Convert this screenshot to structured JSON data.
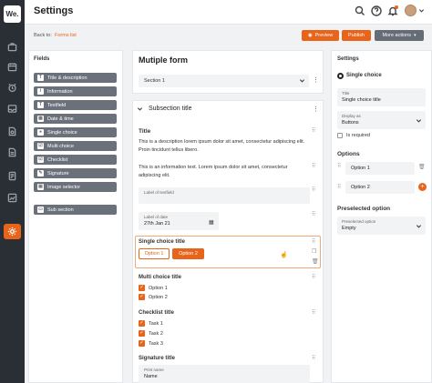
{
  "app": {
    "logo": "We.",
    "title": "Settings"
  },
  "breadcrumb": {
    "back_label": "Back to:",
    "link": "Forms list"
  },
  "actions": {
    "preview": "Preview",
    "publish": "Publish",
    "more": "More actions"
  },
  "fields_panel": {
    "title": "Fields",
    "items": [
      {
        "icon": "T",
        "label": "Title & description"
      },
      {
        "icon": "i",
        "label": "Information"
      },
      {
        "icon": "T",
        "label": "Textfield"
      },
      {
        "icon": "▦",
        "label": "Date & time"
      },
      {
        "icon": "●",
        "label": "Single choice"
      },
      {
        "icon": "☑",
        "label": "Multi choice"
      },
      {
        "icon": "☑",
        "label": "Checklist"
      },
      {
        "icon": "✎",
        "label": "Signature"
      },
      {
        "icon": "▣",
        "label": "Image selector"
      }
    ],
    "sub_section": "Sub section"
  },
  "form": {
    "title": "Mutiple form",
    "section_select": "Section 1",
    "subsection_title": "Subsection title",
    "title_block": {
      "title": "Title",
      "description": "This is a description lorem ipsum dolor sit amet, consectetur adipiscing elit. Proin tincidunt tellus libero.",
      "info": "This is an information text. Lorem ipsum dolor sit amet, consectetur adipiscing elit."
    },
    "textfield_label": "Label of textfield",
    "date": {
      "label": "Label of date",
      "value": "27th Jan 21"
    },
    "single_choice": {
      "title": "Single choice title",
      "option1": "Option 1",
      "option2": "Option 2"
    },
    "multi_choice": {
      "title": "Multi choice title",
      "options": [
        "Option 1",
        "Option 2"
      ]
    },
    "checklist": {
      "title": "Checklist title",
      "tasks": [
        "Task 1",
        "Task 2",
        "Task 3"
      ]
    },
    "signature": {
      "title": "Signature title",
      "print_label": "Print name",
      "print_value": "Name"
    }
  },
  "settings_panel": {
    "title": "Settings",
    "field_type": "Single choice",
    "title_label": "Title",
    "title_value": "Single choice title",
    "display_label": "Display as",
    "display_value": "Buttons",
    "required": "Is required",
    "options_heading": "Options",
    "options": [
      "Option 1",
      "Option 2"
    ],
    "preselected_heading": "Preselected option",
    "preselected_label": "Preselected option",
    "preselected_value": "Empty"
  },
  "colors": {
    "accent": "#e8641b",
    "rail": "#2a2f36",
    "palette_item": "#6b717a"
  }
}
